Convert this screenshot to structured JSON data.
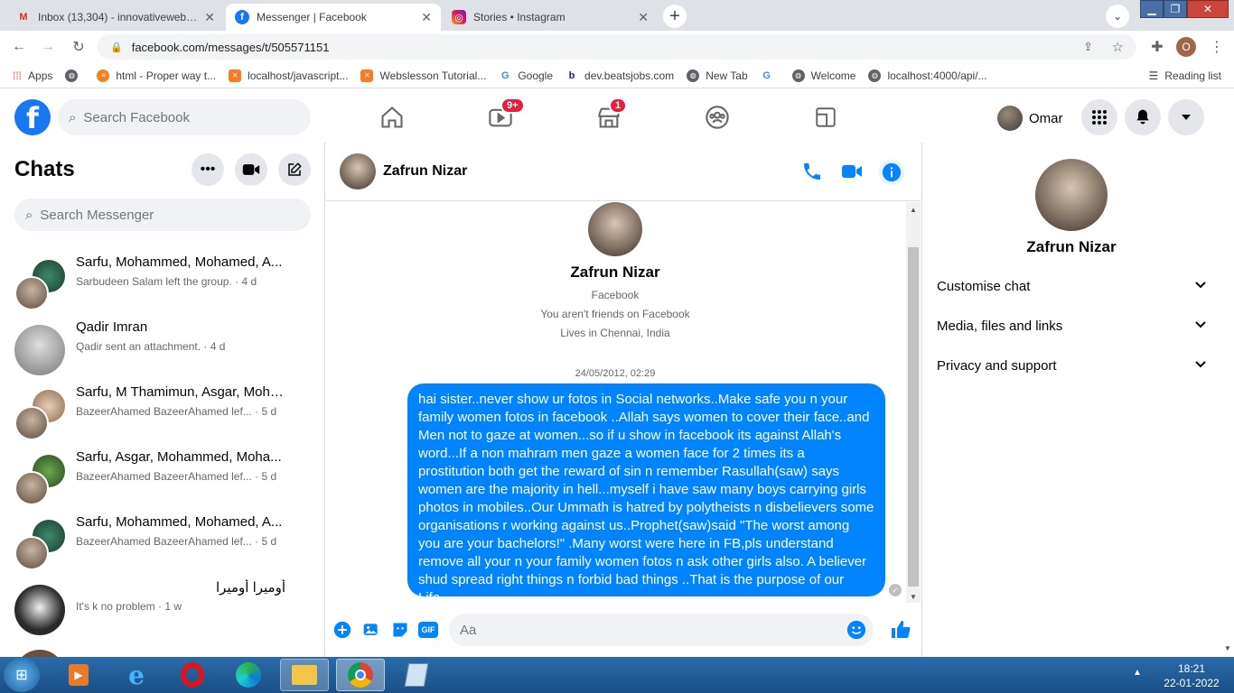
{
  "browser": {
    "tabs": [
      {
        "title": "Inbox (13,304) - innovativewebpa",
        "icon": "gmail-icon",
        "active": false
      },
      {
        "title": "Messenger | Facebook",
        "icon": "facebook-icon",
        "active": true
      },
      {
        "title": "Stories • Instagram",
        "icon": "instagram-icon",
        "active": false
      }
    ],
    "url": "facebook.com/messages/t/505571151",
    "profile_initial": "O",
    "bookmarks": [
      "Apps",
      "",
      "html - Proper way t...",
      "localhost/javascript...",
      "Webslesson Tutorial...",
      "Google",
      "dev.beatsjobs.com",
      "New Tab",
      "",
      "Welcome",
      "localhost:4000/api/..."
    ],
    "reading_list": "Reading list"
  },
  "fb": {
    "search_placeholder": "Search Facebook",
    "watch_badge": "9+",
    "market_badge": "1",
    "user_name": "Omar"
  },
  "chats": {
    "title": "Chats",
    "search_placeholder": "Search Messenger",
    "items": [
      {
        "name": "Sarfu, Mohammed, Mohamed, A...",
        "last": "Sarbudeen Salam left the group. · 4 d"
      },
      {
        "name": "Qadir Imran",
        "last": "Qadir sent an attachment. · 4 d"
      },
      {
        "name": "Sarfu, M Thamimun, Asgar, Moha...",
        "last": "BazeerAhamed BazeerAhamed lef... · 5 d"
      },
      {
        "name": "Sarfu, Asgar, Mohammed, Moha...",
        "last": "BazeerAhamed BazeerAhamed lef... · 5 d"
      },
      {
        "name": "Sarfu, Mohammed, Mohamed, A...",
        "last": "BazeerAhamed BazeerAhamed lef... · 5 d"
      },
      {
        "name": "أوميرا أوميرا",
        "last": "It's k no problem · 1 w"
      }
    ]
  },
  "conversation": {
    "contact": "Zafrun Nizar",
    "profile_source": "Facebook",
    "friend_status": "You aren't friends on Facebook",
    "location": "Lives in Chennai, India",
    "timestamp": "24/05/2012, 02:29",
    "message": "hai sister..never show ur fotos in Social networks..Make safe you n your family women fotos in facebook ..Allah says women to cover their face..and Men not to gaze at women...so if u show in facebook its against Allah's word...If a non mahram men gaze a women face for 2 times its a prostitution both get the reward of sin n remember Rasullah(saw) says women are the majority in hell...myself i have saw many boys carrying girls photos in mobiles..Our Ummath is hatred by polytheists n disbelievers some organisations r working against us..Prophet(saw)said \"The worst among you are your bachelors!\" .Many worst were here in FB,pls understand remove all your n your family women fotos n ask other girls also. A believer shud spread right things n forbid bad things ..That is the purpose of our Life...",
    "composer_placeholder": "Aa"
  },
  "info": {
    "name": "Zafrun Nizar",
    "sections": [
      "Customise chat",
      "Media, files and links",
      "Privacy and support"
    ]
  },
  "taskbar": {
    "time": "18:21",
    "date": "22-01-2022"
  },
  "colors": {
    "fb_blue": "#1877f2",
    "bubble": "#0084ff",
    "badge": "#e41e3f"
  }
}
